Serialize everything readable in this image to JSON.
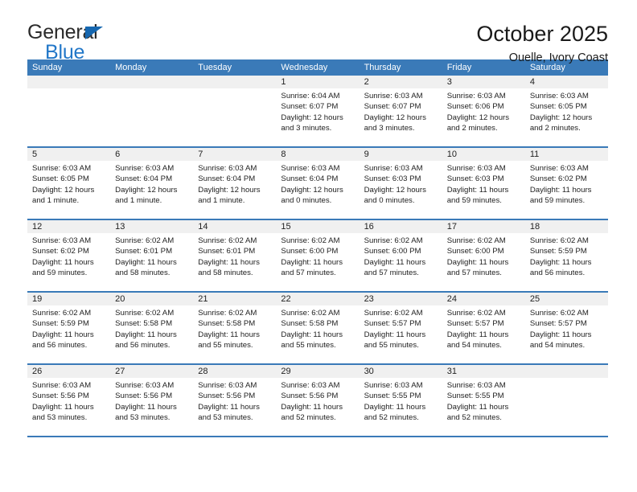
{
  "logo": {
    "word1": "General",
    "word2": "Blue",
    "triangle_color": "#1667b0",
    "word2_color": "#2277c8"
  },
  "header": {
    "title": "October 2025",
    "subtitle": "Ouelle, Ivory Coast"
  },
  "theme": {
    "header_blue": "#3a7ab8",
    "date_band": "#f0f0f0"
  },
  "weekday_headers": [
    "Sunday",
    "Monday",
    "Tuesday",
    "Wednesday",
    "Thursday",
    "Friday",
    "Saturday"
  ],
  "weeks": [
    [
      {
        "day": "",
        "sunrise": "",
        "sunset": "",
        "daylight": "",
        "daylight2": ""
      },
      {
        "day": "",
        "sunrise": "",
        "sunset": "",
        "daylight": "",
        "daylight2": ""
      },
      {
        "day": "",
        "sunrise": "",
        "sunset": "",
        "daylight": "",
        "daylight2": ""
      },
      {
        "day": "1",
        "sunrise": "Sunrise: 6:04 AM",
        "sunset": "Sunset: 6:07 PM",
        "daylight": "Daylight: 12 hours",
        "daylight2": "and 3 minutes."
      },
      {
        "day": "2",
        "sunrise": "Sunrise: 6:03 AM",
        "sunset": "Sunset: 6:07 PM",
        "daylight": "Daylight: 12 hours",
        "daylight2": "and 3 minutes."
      },
      {
        "day": "3",
        "sunrise": "Sunrise: 6:03 AM",
        "sunset": "Sunset: 6:06 PM",
        "daylight": "Daylight: 12 hours",
        "daylight2": "and 2 minutes."
      },
      {
        "day": "4",
        "sunrise": "Sunrise: 6:03 AM",
        "sunset": "Sunset: 6:05 PM",
        "daylight": "Daylight: 12 hours",
        "daylight2": "and 2 minutes."
      }
    ],
    [
      {
        "day": "5",
        "sunrise": "Sunrise: 6:03 AM",
        "sunset": "Sunset: 6:05 PM",
        "daylight": "Daylight: 12 hours",
        "daylight2": "and 1 minute."
      },
      {
        "day": "6",
        "sunrise": "Sunrise: 6:03 AM",
        "sunset": "Sunset: 6:04 PM",
        "daylight": "Daylight: 12 hours",
        "daylight2": "and 1 minute."
      },
      {
        "day": "7",
        "sunrise": "Sunrise: 6:03 AM",
        "sunset": "Sunset: 6:04 PM",
        "daylight": "Daylight: 12 hours",
        "daylight2": "and 1 minute."
      },
      {
        "day": "8",
        "sunrise": "Sunrise: 6:03 AM",
        "sunset": "Sunset: 6:04 PM",
        "daylight": "Daylight: 12 hours",
        "daylight2": "and 0 minutes."
      },
      {
        "day": "9",
        "sunrise": "Sunrise: 6:03 AM",
        "sunset": "Sunset: 6:03 PM",
        "daylight": "Daylight: 12 hours",
        "daylight2": "and 0 minutes."
      },
      {
        "day": "10",
        "sunrise": "Sunrise: 6:03 AM",
        "sunset": "Sunset: 6:03 PM",
        "daylight": "Daylight: 11 hours",
        "daylight2": "and 59 minutes."
      },
      {
        "day": "11",
        "sunrise": "Sunrise: 6:03 AM",
        "sunset": "Sunset: 6:02 PM",
        "daylight": "Daylight: 11 hours",
        "daylight2": "and 59 minutes."
      }
    ],
    [
      {
        "day": "12",
        "sunrise": "Sunrise: 6:03 AM",
        "sunset": "Sunset: 6:02 PM",
        "daylight": "Daylight: 11 hours",
        "daylight2": "and 59 minutes."
      },
      {
        "day": "13",
        "sunrise": "Sunrise: 6:02 AM",
        "sunset": "Sunset: 6:01 PM",
        "daylight": "Daylight: 11 hours",
        "daylight2": "and 58 minutes."
      },
      {
        "day": "14",
        "sunrise": "Sunrise: 6:02 AM",
        "sunset": "Sunset: 6:01 PM",
        "daylight": "Daylight: 11 hours",
        "daylight2": "and 58 minutes."
      },
      {
        "day": "15",
        "sunrise": "Sunrise: 6:02 AM",
        "sunset": "Sunset: 6:00 PM",
        "daylight": "Daylight: 11 hours",
        "daylight2": "and 57 minutes."
      },
      {
        "day": "16",
        "sunrise": "Sunrise: 6:02 AM",
        "sunset": "Sunset: 6:00 PM",
        "daylight": "Daylight: 11 hours",
        "daylight2": "and 57 minutes."
      },
      {
        "day": "17",
        "sunrise": "Sunrise: 6:02 AM",
        "sunset": "Sunset: 6:00 PM",
        "daylight": "Daylight: 11 hours",
        "daylight2": "and 57 minutes."
      },
      {
        "day": "18",
        "sunrise": "Sunrise: 6:02 AM",
        "sunset": "Sunset: 5:59 PM",
        "daylight": "Daylight: 11 hours",
        "daylight2": "and 56 minutes."
      }
    ],
    [
      {
        "day": "19",
        "sunrise": "Sunrise: 6:02 AM",
        "sunset": "Sunset: 5:59 PM",
        "daylight": "Daylight: 11 hours",
        "daylight2": "and 56 minutes."
      },
      {
        "day": "20",
        "sunrise": "Sunrise: 6:02 AM",
        "sunset": "Sunset: 5:58 PM",
        "daylight": "Daylight: 11 hours",
        "daylight2": "and 56 minutes."
      },
      {
        "day": "21",
        "sunrise": "Sunrise: 6:02 AM",
        "sunset": "Sunset: 5:58 PM",
        "daylight": "Daylight: 11 hours",
        "daylight2": "and 55 minutes."
      },
      {
        "day": "22",
        "sunrise": "Sunrise: 6:02 AM",
        "sunset": "Sunset: 5:58 PM",
        "daylight": "Daylight: 11 hours",
        "daylight2": "and 55 minutes."
      },
      {
        "day": "23",
        "sunrise": "Sunrise: 6:02 AM",
        "sunset": "Sunset: 5:57 PM",
        "daylight": "Daylight: 11 hours",
        "daylight2": "and 55 minutes."
      },
      {
        "day": "24",
        "sunrise": "Sunrise: 6:02 AM",
        "sunset": "Sunset: 5:57 PM",
        "daylight": "Daylight: 11 hours",
        "daylight2": "and 54 minutes."
      },
      {
        "day": "25",
        "sunrise": "Sunrise: 6:02 AM",
        "sunset": "Sunset: 5:57 PM",
        "daylight": "Daylight: 11 hours",
        "daylight2": "and 54 minutes."
      }
    ],
    [
      {
        "day": "26",
        "sunrise": "Sunrise: 6:03 AM",
        "sunset": "Sunset: 5:56 PM",
        "daylight": "Daylight: 11 hours",
        "daylight2": "and 53 minutes."
      },
      {
        "day": "27",
        "sunrise": "Sunrise: 6:03 AM",
        "sunset": "Sunset: 5:56 PM",
        "daylight": "Daylight: 11 hours",
        "daylight2": "and 53 minutes."
      },
      {
        "day": "28",
        "sunrise": "Sunrise: 6:03 AM",
        "sunset": "Sunset: 5:56 PM",
        "daylight": "Daylight: 11 hours",
        "daylight2": "and 53 minutes."
      },
      {
        "day": "29",
        "sunrise": "Sunrise: 6:03 AM",
        "sunset": "Sunset: 5:56 PM",
        "daylight": "Daylight: 11 hours",
        "daylight2": "and 52 minutes."
      },
      {
        "day": "30",
        "sunrise": "Sunrise: 6:03 AM",
        "sunset": "Sunset: 5:55 PM",
        "daylight": "Daylight: 11 hours",
        "daylight2": "and 52 minutes."
      },
      {
        "day": "31",
        "sunrise": "Sunrise: 6:03 AM",
        "sunset": "Sunset: 5:55 PM",
        "daylight": "Daylight: 11 hours",
        "daylight2": "and 52 minutes."
      },
      {
        "day": "",
        "sunrise": "",
        "sunset": "",
        "daylight": "",
        "daylight2": ""
      }
    ]
  ]
}
